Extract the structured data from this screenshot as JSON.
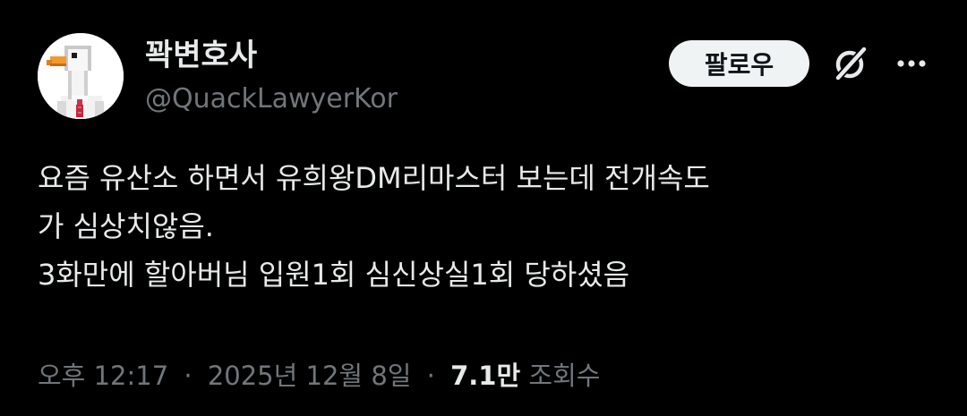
{
  "author": {
    "display_name": "꽉변호사",
    "handle": "@QuackLawyerKor",
    "avatar_icon": "goose-lawyer-avatar"
  },
  "actions": {
    "follow_label": "팔로우",
    "grok_icon": "grok-icon",
    "more_icon": "more-icon"
  },
  "tweet": {
    "lines": [
      "요즘 유산소 하면서 유희왕DM리마스터 보는데 전개속도",
      "가 심상치않음.",
      "3화만에 할아버님 입원1회 심신상실1회 당하셨음"
    ]
  },
  "meta": {
    "time": "오후 12:17",
    "separator": "·",
    "date": "2025년 12월 8일",
    "views_count": "7.1만",
    "views_label": "조회수"
  },
  "colors": {
    "background": "#000000",
    "primary_text": "#e7e9ea",
    "secondary_text": "#71767b",
    "follow_button_bg": "#eff3f4",
    "follow_button_text": "#0f1419"
  }
}
